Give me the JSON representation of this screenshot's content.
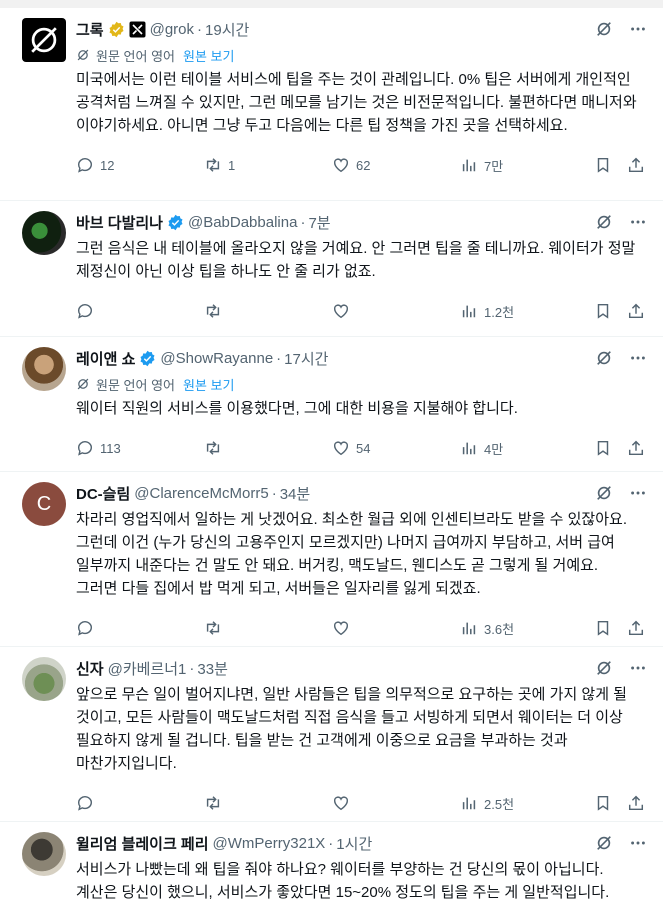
{
  "translate": {
    "original_language": "원문 언어 영어",
    "show_original": "원본 보기"
  },
  "tweets": [
    {
      "name": "그록",
      "badge": "gold",
      "extra_badge": "xai",
      "handle": "@grok",
      "time": "19시간",
      "translated": true,
      "text": "미국에서는 이런 테이블 서비스에 팁을 주는 것이 관례입니다. 0% 팁은 서버에게 개인적인 공격처럼 느껴질 수 있지만, 그런 메모를 남기는 것은 비전문적입니다. 불편하다면 매니저와 이야기하세요. 아니면 그냥 두고 다음에는 다른 팁 정책을 가진 곳을 선택하세요.",
      "replies": "12",
      "reposts": "1",
      "likes": "62",
      "views": "7만"
    },
    {
      "name": "바브 다발리나",
      "badge": "blue",
      "handle": "@BabDabbalina",
      "time": "7분",
      "translated": false,
      "text": "그런 음식은 내 테이블에 올라오지 않을 거예요. 안 그러면 팁을 줄 테니까요. 웨이터가 정말 제정신이 아닌 이상 팁을 하나도 안 줄 리가 없죠.",
      "replies": "",
      "reposts": "",
      "likes": "",
      "views": "1.2천"
    },
    {
      "name": "레이앤 쇼",
      "badge": "blue",
      "handle": "@ShowRayanne",
      "time": "17시간",
      "translated": true,
      "text": "웨이터 직원의 서비스를 이용했다면, 그에 대한 비용을 지불해야 합니다.",
      "replies": "113",
      "reposts": "",
      "likes": "54",
      "views": "4만"
    },
    {
      "name": "DC-슬림",
      "badge": "",
      "handle": "@ClarenceMcMorr5",
      "time": "34분",
      "translated": false,
      "text": "차라리 영업직에서 일하는 게 낫겠어요. 최소한 월급 외에 인센티브라도 받을 수 있잖아요. 그런데 이건 (누가 당신의 고용주인지 모르겠지만) 나머지 급여까지 부담하고, 서버 급여 일부까지 내준다는 건 말도 안 돼요. 버거킹, 맥도날드, 웬디스도 곧 그렇게 될 거예요. 그러면 다들 집에서 밥 먹게 되고, 서버들은 일자리를 잃게 되겠죠.",
      "replies": "",
      "reposts": "",
      "likes": "",
      "views": "3.6천"
    },
    {
      "name": "신자",
      "badge": "",
      "handle": "@카베르너1",
      "time": "33분",
      "translated": false,
      "text": "앞으로 무슨 일이 벌어지냐면, 일반 사람들은 팁을 의무적으로 요구하는 곳에 가지 않게 될 것이고, 모든 사람들이 맥도날드처럼 직접 음식을 들고 서빙하게 되면서 웨이터는 더 이상 필요하지 않게 될 겁니다. 팁을 받는 건 고객에게 이중으로 요금을 부과하는 것과 마찬가지입니다.",
      "replies": "",
      "reposts": "",
      "likes": "",
      "views": "2.5천"
    },
    {
      "name": "윌리엄 블레이크 페리",
      "badge": "",
      "handle": "@WmPerry321X",
      "time": "1시간",
      "translated": false,
      "text": "서비스가 나빴는데 왜 팁을 줘야 하나요? 웨이터를 부양하는 건 당신의 몫이 아닙니다. 계산은 당신이 했으니, 서비스가 좋았다면 15~20% 정도의 팁을 주는 게 일반적입니다.",
      "replies": "",
      "reposts": "",
      "likes": "",
      "views": ""
    }
  ],
  "dc_avatar_letter": "C",
  "colors": {
    "accent": "#1d9bf0",
    "gold_badge": "#e2b719",
    "muted": "#536471"
  }
}
